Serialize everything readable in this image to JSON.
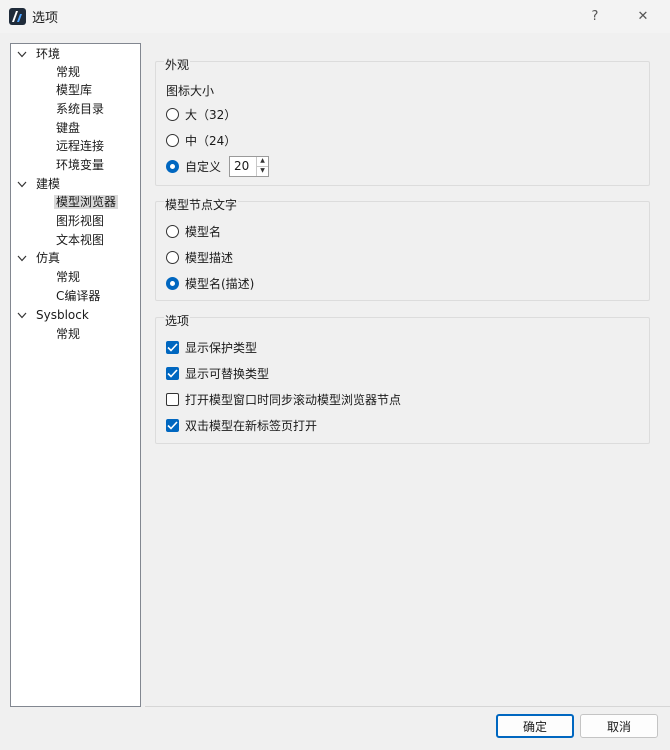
{
  "window": {
    "title": "选项",
    "help_icon": "?",
    "close_icon": "✕",
    "app_icon": "app-logo-icon"
  },
  "tree": [
    {
      "label": "环境",
      "expanded": true,
      "children": [
        "常规",
        "模型库",
        "系统目录",
        "键盘",
        "远程连接",
        "环境变量"
      ]
    },
    {
      "label": "建模",
      "expanded": true,
      "children": [
        "模型浏览器",
        "图形视图",
        "文本视图"
      ]
    },
    {
      "label": "仿真",
      "expanded": true,
      "children": [
        "常规",
        "C编译器"
      ]
    },
    {
      "label": "Sysblock",
      "expanded": true,
      "children": [
        "常规"
      ]
    }
  ],
  "selected_item": "模型浏览器",
  "appearance": {
    "title": "外观",
    "icon_size_label": "图标大小",
    "options": [
      "大（32）",
      "中（24）",
      "自定义"
    ],
    "selected": "自定义",
    "custom_value": "20"
  },
  "node_text": {
    "title": "模型节点文字",
    "options": [
      "模型名",
      "模型描述",
      "模型名(描述)"
    ],
    "selected": "模型名(描述)"
  },
  "options_group": {
    "title": "选项",
    "items": [
      {
        "label": "显示保护类型",
        "checked": true
      },
      {
        "label": "显示可替换类型",
        "checked": true
      },
      {
        "label": "打开模型窗口时同步滚动模型浏览器节点",
        "checked": false
      },
      {
        "label": "双击模型在新标签页打开",
        "checked": true
      }
    ]
  },
  "buttons": {
    "ok": "确定",
    "cancel": "取消"
  },
  "colors": {
    "accent": "#0067c0",
    "background": "#f0f0f0",
    "selection": "#d9d9d9"
  }
}
